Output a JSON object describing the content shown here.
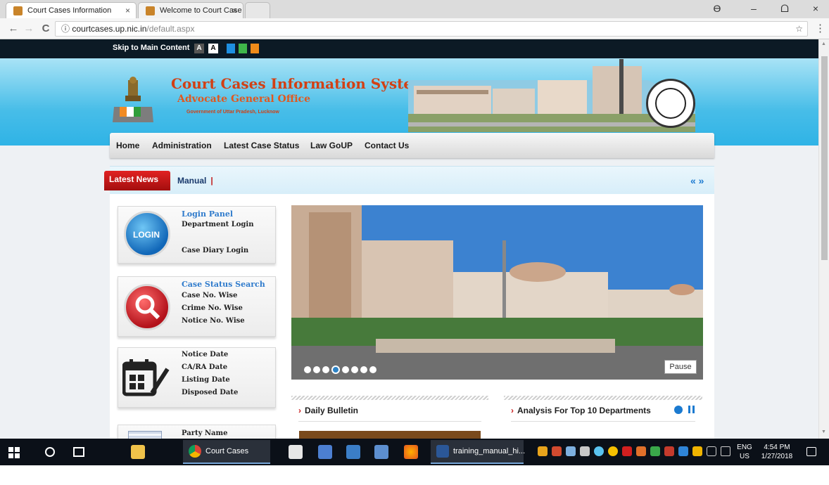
{
  "browser": {
    "tabs": [
      {
        "label": "Court Cases Information",
        "close": "×"
      },
      {
        "label": "Welcome to Court Case",
        "close": "×"
      }
    ],
    "url_host": "courtcases.up.nic.in",
    "url_path": "/default.aspx",
    "info_icon": "ⓘ",
    "back": "←",
    "forward": "→",
    "reload": "C",
    "star": "☆",
    "menu": "⋮",
    "window": {
      "profile": "ϴ",
      "minimize": "–",
      "maximize": "ᗝ",
      "close": "×"
    }
  },
  "access_bar": {
    "skip_label": "Skip to Main Content",
    "font_a1": "A",
    "font_a2": "A",
    "swatches": [
      "#1e8fe0",
      "#3fb54a",
      "#ef8b1a"
    ]
  },
  "header": {
    "title": "Court Cases Information System",
    "subtitle": "Advocate General Office",
    "subtitle2": "Government of Uttar Pradesh, Lucknow"
  },
  "nav": {
    "items": [
      "Home",
      "Administration",
      "Latest Case Status",
      "Law GoUP",
      "Contact Us"
    ]
  },
  "news": {
    "tag": "Latest News",
    "text": "Manual",
    "pipe": "|",
    "controls": "« »"
  },
  "cards": {
    "login": {
      "title": "Login Panel",
      "line1": "Department Login",
      "line2": "Case Diary Login",
      "icon_text": "LOGIN"
    },
    "search": {
      "title": "Case Status Search",
      "line1": "Case No. Wise",
      "line2": "Crime No. Wise",
      "line3": "Notice No. Wise"
    },
    "dates": {
      "line1": "Notice Date",
      "line2": "CA/RA Date",
      "line3": "Listing Date",
      "line4": "Disposed Date"
    },
    "party": {
      "line1": "Party Name"
    }
  },
  "slider": {
    "dot_count": 8,
    "active_dot": 4,
    "pause_label": "Pause"
  },
  "panels": {
    "bulletin": "Daily Bulletin",
    "analysis": "Analysis For Top 10 Departments",
    "arrow": "›"
  },
  "taskbar": {
    "task_chrome": "Court Cases Inform...",
    "task_word": "training_manual_hi...",
    "lang_top": "ENG",
    "lang_bottom": "US",
    "time": "4:54 PM",
    "date": "1/27/2018"
  }
}
